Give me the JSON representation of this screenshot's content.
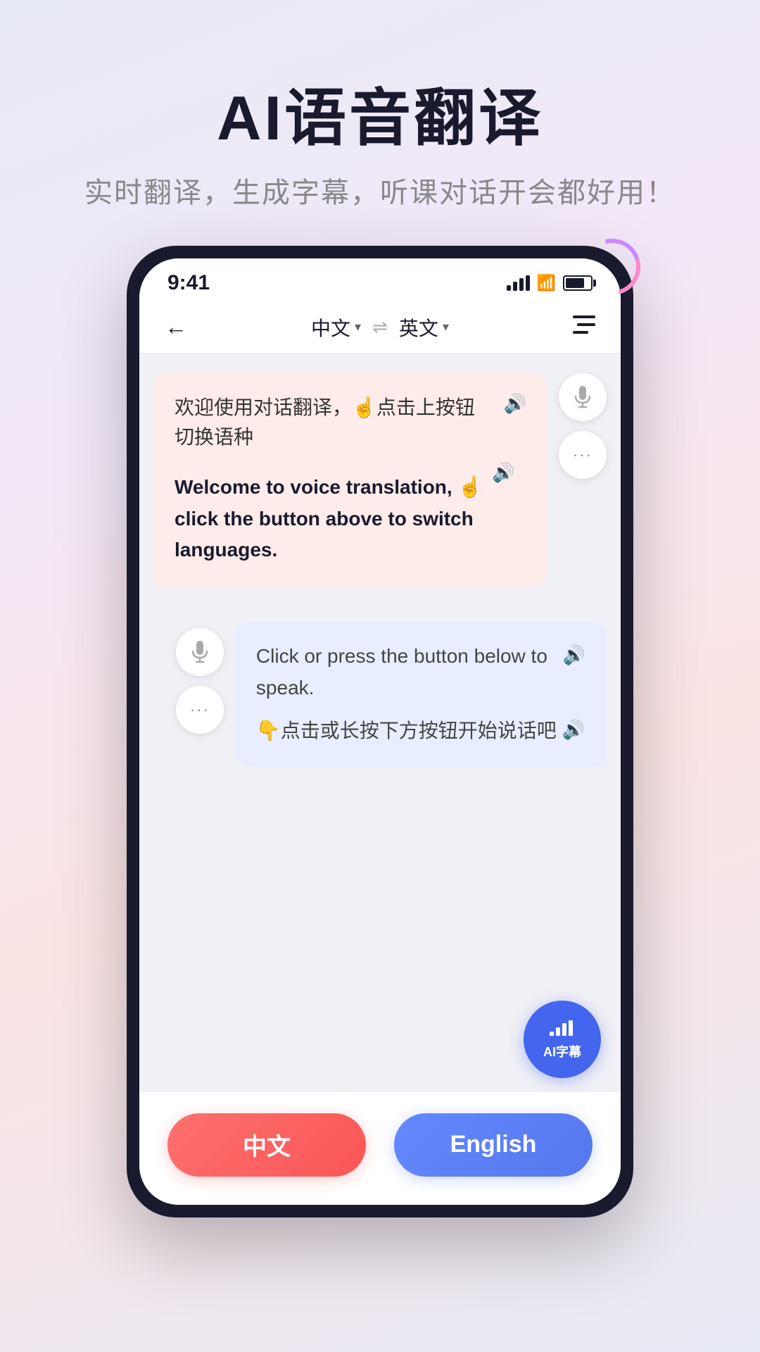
{
  "header": {
    "main_title": "AI语音翻译",
    "subtitle": "实时翻译，生成字幕，听课对话开会都好用！"
  },
  "phone": {
    "status_bar": {
      "time": "9:41"
    },
    "nav": {
      "back_icon": "←",
      "lang_left": "中文",
      "swap_icon": "⇌",
      "lang_right": "英文",
      "right_icon": "≡"
    },
    "bubble_left": {
      "text_cn": "欢迎使用对话翻译，☝点击上按钮切换语种",
      "text_en": "Welcome to voice translation, ☝\nclick the button above to switch\nlanguages.",
      "sound_icon": "🔊"
    },
    "side_buttons_left": {
      "mic_icon": "🎤",
      "more_icon": "···"
    },
    "side_buttons_right": {
      "mic_icon": "🎤",
      "more_icon": "···"
    },
    "bubble_right": {
      "text_en": "Click or press the button below to speak.",
      "text_cn": "👇点击或长按下方按钮开始说话吧",
      "sound_icon": "🔊"
    },
    "ai_caption": {
      "icon": "📊",
      "label": "AI字幕"
    },
    "bottom_btn_cn": "中文",
    "bottom_btn_en": "English"
  },
  "colors": {
    "accent_blue": "#4466ee",
    "accent_red": "#f95555",
    "bg_gradient_start": "#e8eaf6",
    "bg_gradient_end": "#fce4e4"
  }
}
